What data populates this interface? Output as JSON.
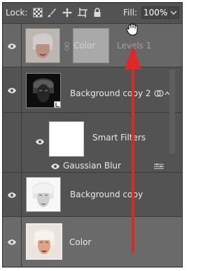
{
  "toolbar": {
    "lock_label": "Lock:",
    "fill_label": "Fill:",
    "fill_value": "100%",
    "lock_icons": [
      "lock-transparent-icon",
      "lock-paint-icon",
      "lock-move-icon",
      "lock-artboard-icon",
      "lock-all-icon"
    ]
  },
  "layers": [
    {
      "name": "Color",
      "mask_name": "Levels 1",
      "selected": true,
      "dragging": true
    },
    {
      "name": "Background copy 2",
      "smart_object": true
    },
    {
      "smart_filters_label": "Smart Filters",
      "filter_name": "Gaussian Blur"
    },
    {
      "name": "Background copy"
    },
    {
      "name": "Color",
      "highlighted": true
    }
  ],
  "colors": {
    "panel_bg": "#535353",
    "selected_row_bg": "#676767",
    "arrow_red": "#e02727"
  }
}
